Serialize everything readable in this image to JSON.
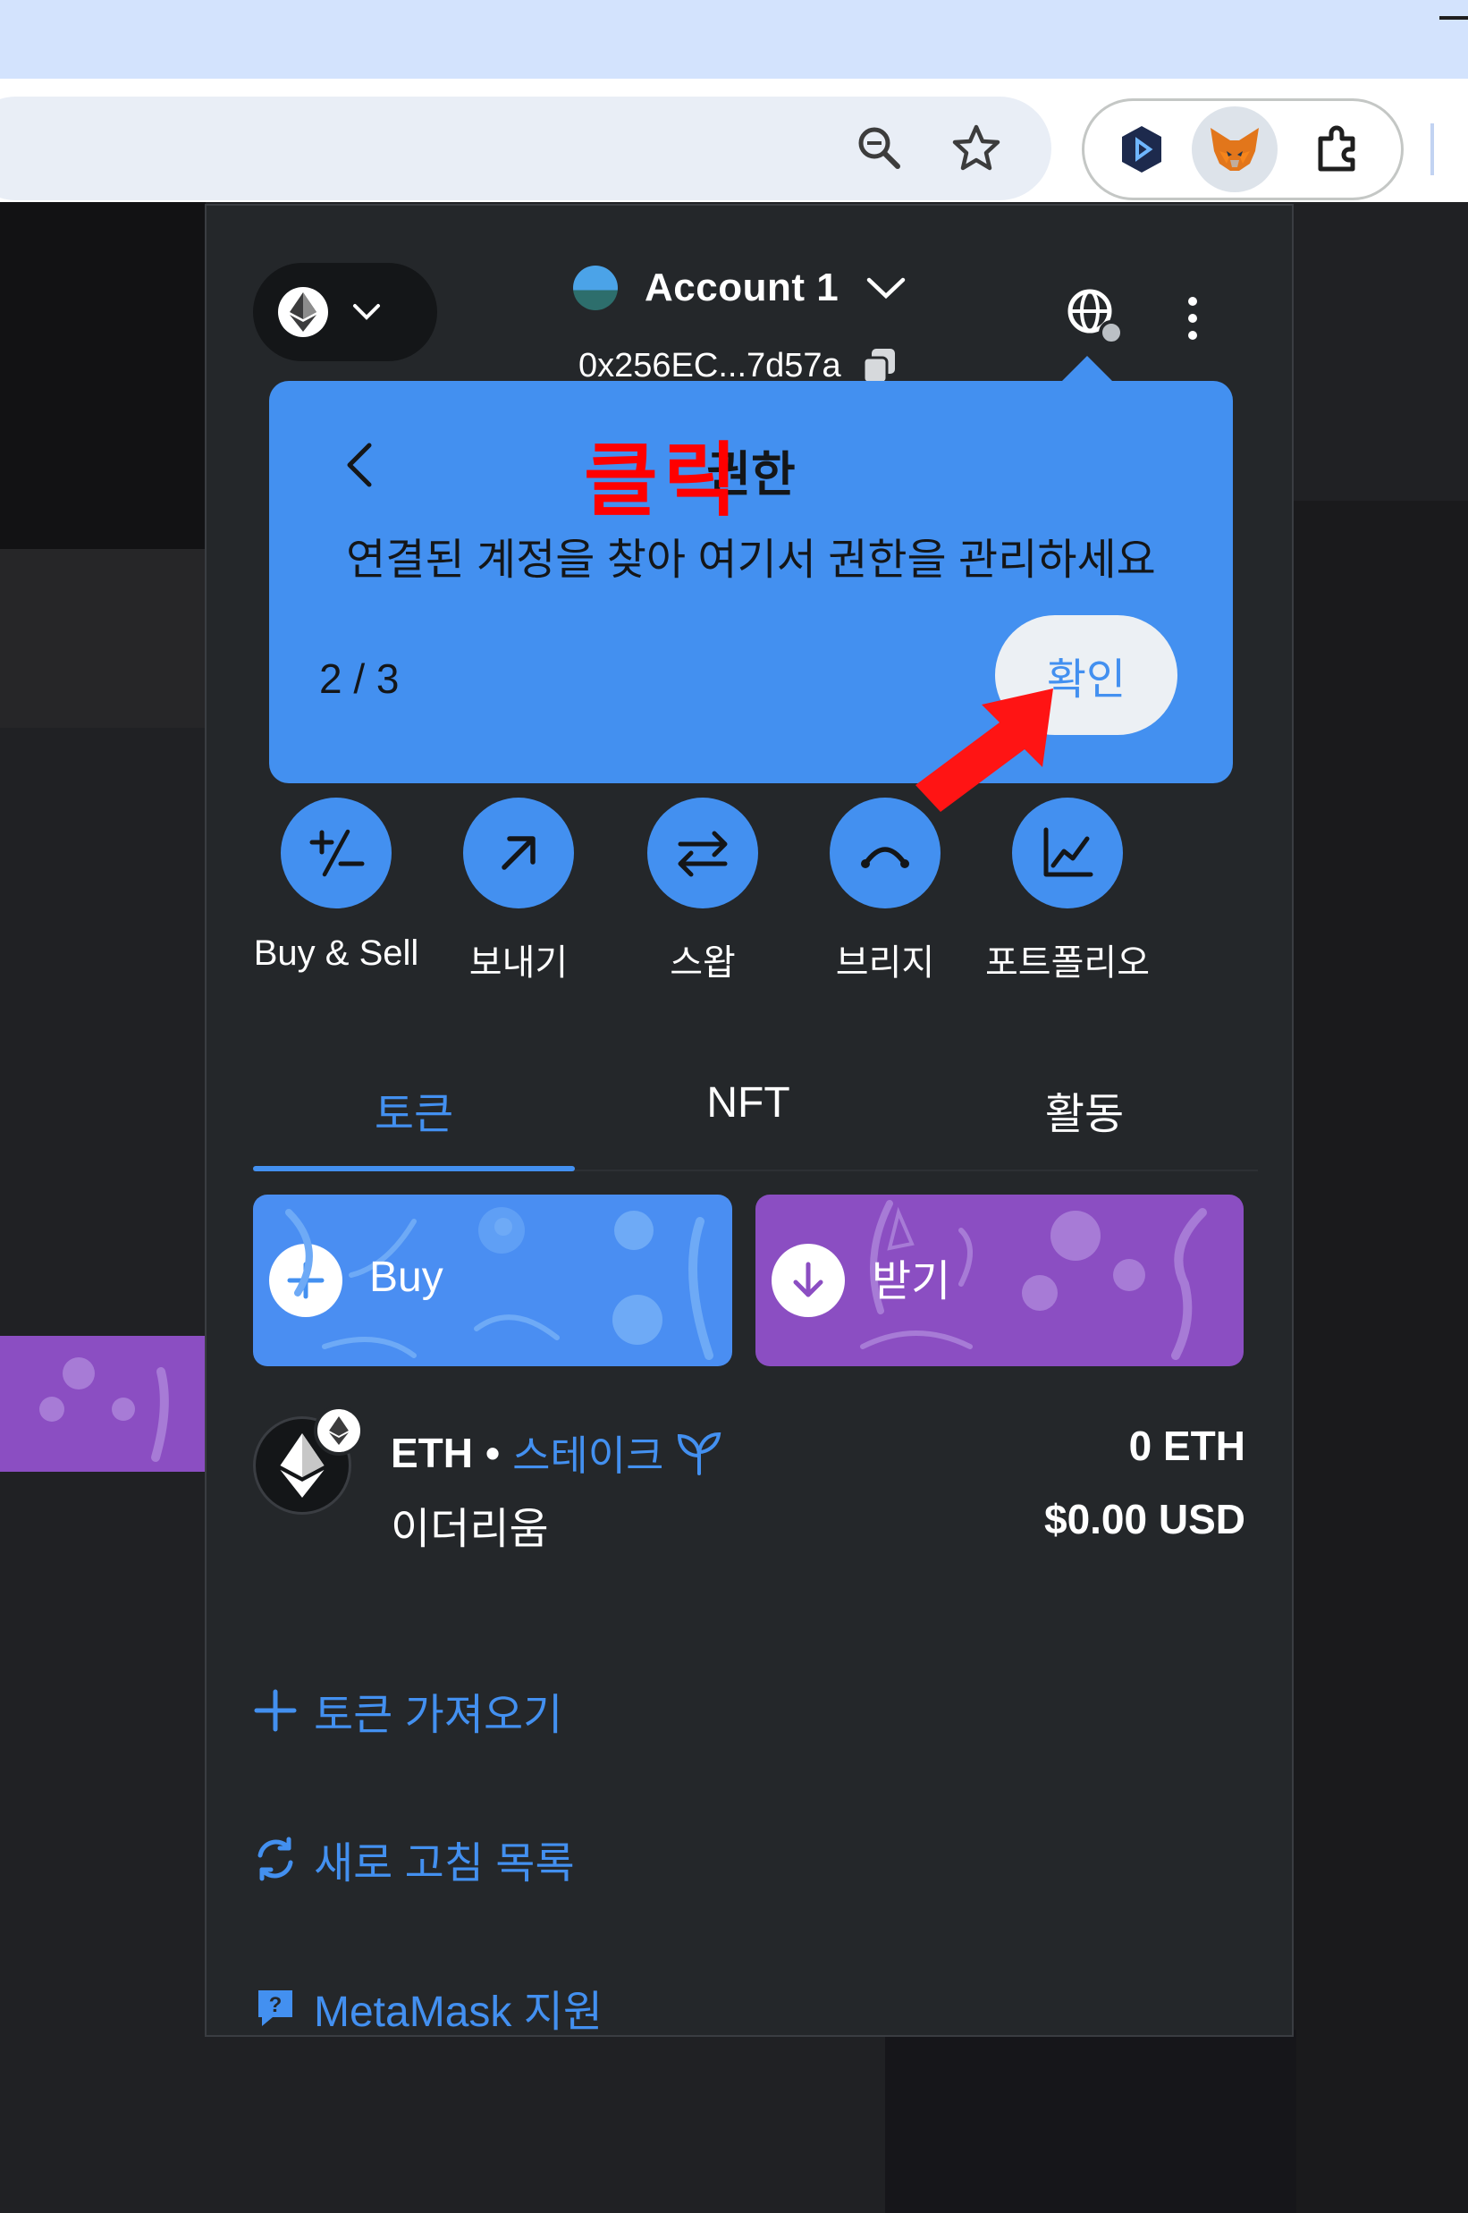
{
  "browser": {
    "toolbar_icons": [
      "zoom-icon",
      "bookmark-star-icon"
    ],
    "extensions": [
      "shield-extension-icon",
      "metamask-fox-icon",
      "extensions-puzzle-icon"
    ]
  },
  "header": {
    "network_icon": "ethereum-icon",
    "account_name": "Account 1",
    "address": "0x256EC...7d57a"
  },
  "tooltip": {
    "title": "권한",
    "body": "연결된 계정을 찾아 여기서 권한을 관리하세요",
    "step": "2 / 3",
    "confirm_label": "확인"
  },
  "annotation": {
    "click_label": "클릭",
    "color": "#ff0000"
  },
  "actions": [
    {
      "label": "Buy & Sell",
      "icon": "plus-minus-icon"
    },
    {
      "label": "보내기",
      "icon": "arrow-up-right-icon"
    },
    {
      "label": "스왑",
      "icon": "swap-arrows-icon"
    },
    {
      "label": "브리지",
      "icon": "bridge-icon"
    },
    {
      "label": "포트폴리오",
      "icon": "chart-icon"
    }
  ],
  "tabs": [
    {
      "label": "토큰",
      "active": true
    },
    {
      "label": "NFT",
      "active": false
    },
    {
      "label": "활동",
      "active": false
    }
  ],
  "banners": {
    "buy_label": "Buy",
    "receive_label": "받기"
  },
  "token": {
    "symbol": "ETH",
    "separator": "•",
    "stake_label": "스테이크",
    "name": "이더리움",
    "amount": "0 ETH",
    "fiat": "$0.00 USD"
  },
  "links": {
    "import_tokens": "토큰 가져오기",
    "refresh_list": "새로 고침 목록",
    "support": "MetaMask 지원"
  },
  "colors": {
    "accent": "#4390f0",
    "popup_bg": "#24272a",
    "receive_banner": "#8b4ec2",
    "annotation": "#ff0000"
  }
}
